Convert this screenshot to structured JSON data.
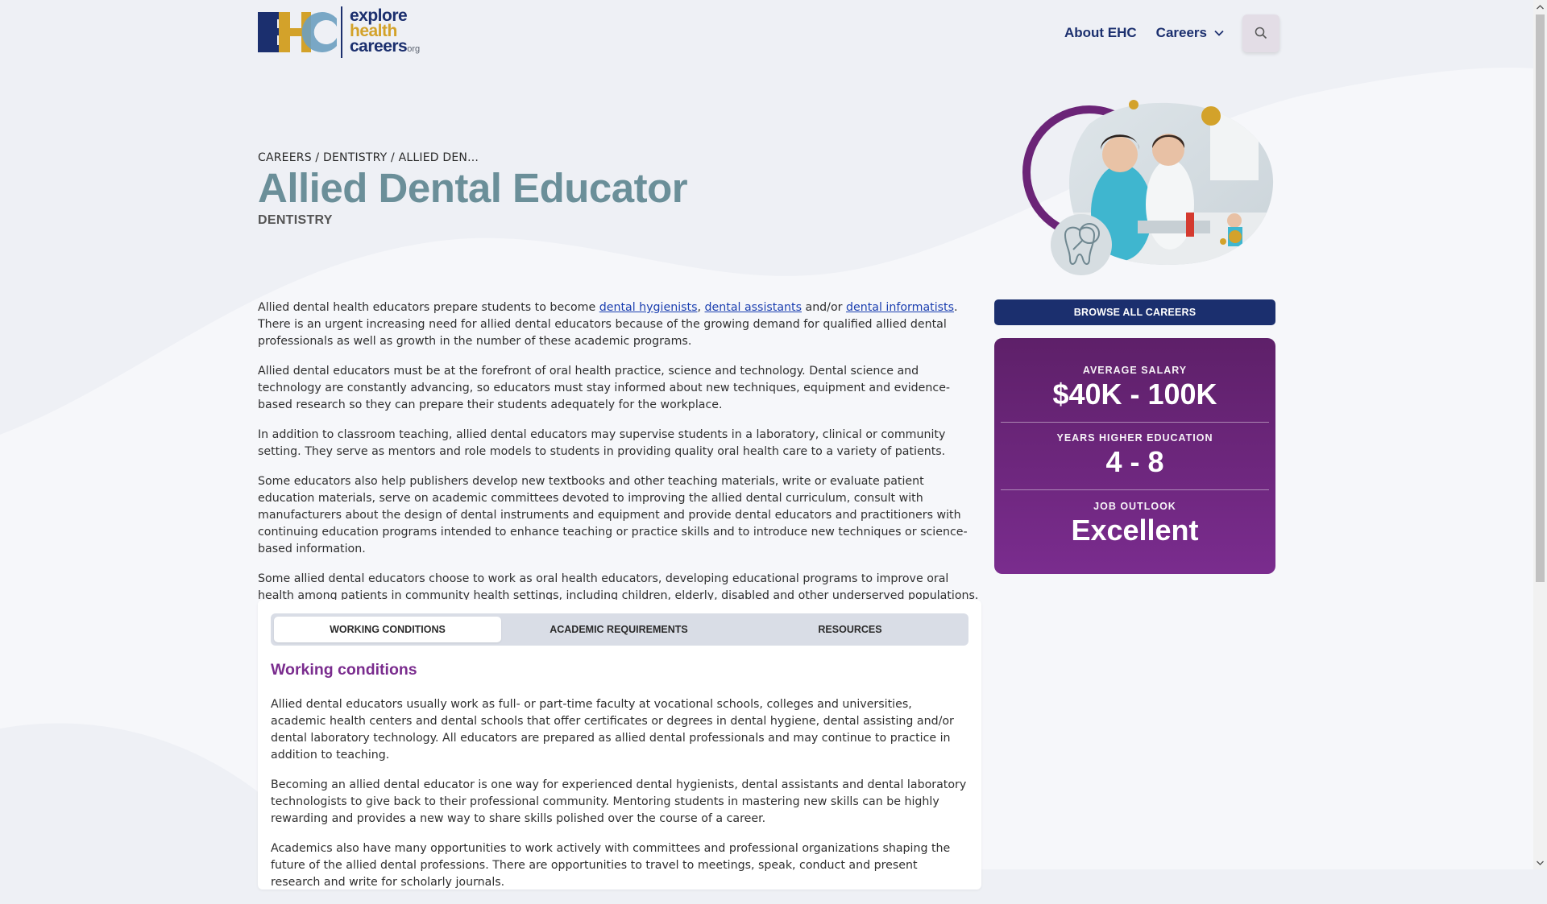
{
  "logo": {
    "line1": "explore",
    "line2": "health",
    "line3": "careers",
    "suffix": "org"
  },
  "nav": {
    "about": "About EHC",
    "careers": "Careers",
    "icons": {
      "careers": "chevron-down-icon",
      "search": "search-icon"
    }
  },
  "hero": {
    "breadcrumb": "CAREERS / DENTISTRY / ALLIED DEN...",
    "title": "Allied Dental Educator",
    "subtitle": "DENTISTRY"
  },
  "content": {
    "p1": {
      "t1": "Allied dental health educators prepare students to become ",
      "l1": "dental hygienists",
      "t2": ", ",
      "l2": "dental assistants",
      "t3": " and/or ",
      "l3": "dental informatists",
      "t4": ". There is an urgent increasing need for allied dental educators because of the growing demand for qualified allied dental professionals as well as growth in the number of these academic programs."
    },
    "p2": "Allied dental educators must be at the forefront of oral health practice, science and technology. Dental science and technology are constantly advancing, so educators must stay informed about new techniques, equipment and evidence-based research so they can prepare their students adequately for the workplace.",
    "p3": "In addition to classroom teaching, allied dental educators may supervise students in a laboratory, clinical or community setting.  They serve as mentors and role models to students in providing quality oral health care to a variety of patients.",
    "p4": "Some educators also help publishers develop new textbooks and other teaching materials, write or evaluate patient education materials, serve on academic committees devoted to improving the allied dental curriculum, consult with manufacturers about the design of dental instruments and equipment and provide dental educators and practitioners with continuing education programs intended to enhance teaching or practice skills and to introduce new techniques or science-based information.",
    "p5": "Some allied dental educators choose to work as oral health educators, developing educational programs to improve oral health among patients in community health settings, including children, elderly, disabled and other underserved populations."
  },
  "sidebar": {
    "browse": "BROWSE ALL CAREERS",
    "stats": [
      {
        "label": "AVERAGE SALARY",
        "value": "$40K - 100K"
      },
      {
        "label": "YEARS HIGHER EDUCATION",
        "value": "4 - 8"
      },
      {
        "label": "JOB OUTLOOK",
        "value": "Excellent"
      }
    ]
  },
  "tabs": {
    "items": [
      {
        "label": "WORKING CONDITIONS",
        "active": true
      },
      {
        "label": "ACADEMIC REQUIREMENTS",
        "active": false
      },
      {
        "label": "RESOURCES",
        "active": false
      }
    ],
    "heading": "Working conditions",
    "body": [
      "Allied dental educators usually work as full- or part-time faculty at vocational schools, colleges and universities, academic health centers and dental schools that offer certificates or degrees in dental hygiene, dental assisting and/or dental laboratory technology. All educators are prepared as allied dental professionals and may continue to practice in addition to teaching.",
      "Becoming an allied dental educator is one way for experienced dental hygienists, dental assistants and dental laboratory technologists to give back to their professional community. Mentoring students in mastering new skills can be highly rewarding and provides a new way to share skills polished over the course of a career.",
      "Academics also have many opportunities to work actively with committees and professional organizations shaping the future of the allied dental professions. There are opportunities to travel to meetings, speak, conduct and present research and write for scholarly journals."
    ]
  },
  "colors": {
    "navy": "#1b2f6e",
    "gold": "#d3a22a",
    "purple": "#7a2c8e",
    "title_teal": "#6b8f99",
    "link": "#1b3fb0"
  },
  "hero_icons": [
    "tooth-magnifier-icon"
  ]
}
